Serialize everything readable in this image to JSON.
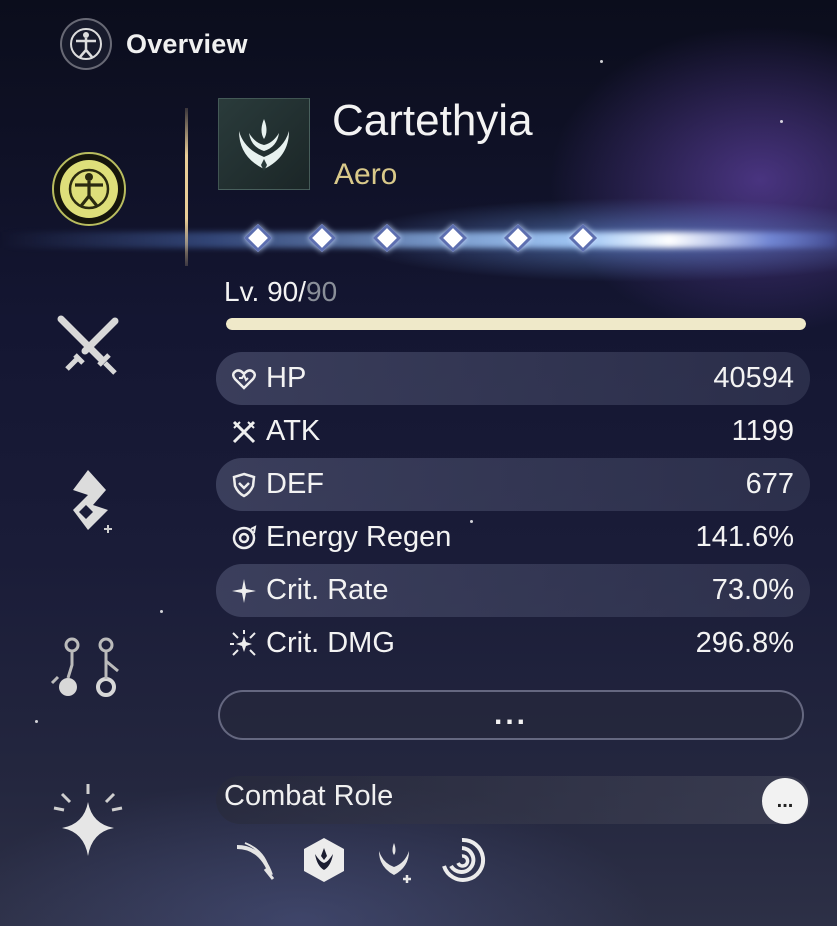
{
  "header": {
    "title": "Overview",
    "icon": "vitruvian-icon"
  },
  "sidebar": {
    "items": [
      {
        "name": "overview",
        "icon": "vitruvian-icon",
        "active": true
      },
      {
        "name": "weapon",
        "icon": "crossed-swords-icon"
      },
      {
        "name": "echo",
        "icon": "echo-icon"
      },
      {
        "name": "forte",
        "icon": "forte-nodes-icon"
      },
      {
        "name": "resonance-chain",
        "icon": "sparkle-star-icon"
      }
    ]
  },
  "character": {
    "name": "Cartethyia",
    "element": "Aero",
    "element_color": "#d9c98a",
    "sequence_nodes": 6
  },
  "level": {
    "label": "Lv. ",
    "current": "90",
    "separator": "/",
    "max": "90",
    "progress": 1.0
  },
  "stats": [
    {
      "icon": "heart-icon",
      "label": "HP",
      "value": "40594"
    },
    {
      "icon": "atk-icon",
      "label": "ATK",
      "value": "1199"
    },
    {
      "icon": "shield-icon",
      "label": "DEF",
      "value": "677"
    },
    {
      "icon": "energy-regen-icon",
      "label": "Energy Regen",
      "value": "141.6%"
    },
    {
      "icon": "crit-rate-icon",
      "label": "Crit. Rate",
      "value": "73.0%"
    },
    {
      "icon": "crit-dmg-icon",
      "label": "Crit. DMG",
      "value": "296.8%"
    }
  ],
  "more_button": {
    "label": "..."
  },
  "combat_role": {
    "label": "Combat Role",
    "info_label": "...",
    "icons": [
      "slash-icon",
      "hexagon-emblem-icon",
      "aero-plus-icon",
      "swirl-icon"
    ]
  }
}
